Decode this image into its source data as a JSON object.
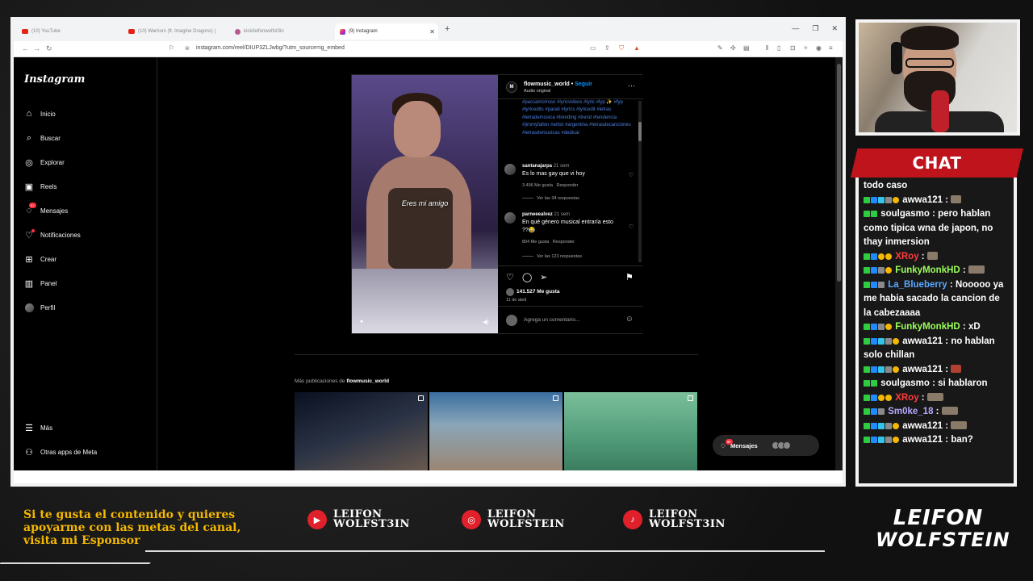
{
  "browser": {
    "tabs": [
      {
        "label": "(10) YouTube",
        "icon": "youtube-icon"
      },
      {
        "label": "(10) Warriors (ft. Imagine Dragons) |",
        "icon": "youtube-icon"
      },
      {
        "label": "kick/leifonwolfst3in",
        "icon": "kick-icon"
      },
      {
        "label": "(9) Instagram",
        "icon": "instagram-icon",
        "active": true
      }
    ],
    "new_tab": "+",
    "url": "instagram.com/reel/DIUP3ZLJwbg/?utm_source=ig_embed"
  },
  "instagram": {
    "logo": "Instagram",
    "nav": [
      {
        "label": "Inicio",
        "icon": "home-icon"
      },
      {
        "label": "Buscar",
        "icon": "search-icon"
      },
      {
        "label": "Explorar",
        "icon": "compass-icon"
      },
      {
        "label": "Reels",
        "icon": "reels-icon"
      },
      {
        "label": "Mensajes",
        "icon": "messenger-icon",
        "badge": "9+"
      },
      {
        "label": "Notificaciones",
        "icon": "heart-icon"
      },
      {
        "label": "Crear",
        "icon": "plus-square-icon"
      },
      {
        "label": "Panel",
        "icon": "dashboard-icon"
      },
      {
        "label": "Perfil",
        "icon": "avatar"
      }
    ],
    "nav_bottom": [
      {
        "label": "Más",
        "icon": "menu-icon"
      },
      {
        "label": "Otras apps de Meta",
        "icon": "meta-apps-icon"
      }
    ],
    "post": {
      "subtitle": "Eres mi amigo",
      "username": "flowmusic_world",
      "follow": "Seguir",
      "audio": "Audio original",
      "caption": "#paccamorroso #lyricvideos #lyric #lyp ✨ #fyp #lyricedits #parati #lyrics #lyricedit #letras #letrademusica #trending #trend #tendencia #jimmyfallon #artist #argentina #letrasdecanciones #letrasdemusicas #dedicar",
      "comments": [
        {
          "user": "santanajarpa",
          "time": "21 sem",
          "text": "Es lo mas gay que vi hoy",
          "likes": "3.496 Me gusta",
          "reply": "Responder",
          "replies": "Ver las 34 respuestas"
        },
        {
          "user": "parneeealvez",
          "time": "21 sem",
          "text": "En qué género musical entraría esto ??😂",
          "likes": "804 Me gusta",
          "reply": "Responder",
          "replies": "Ver las 123 respuestas"
        }
      ],
      "likes": "141.527 Me gusta",
      "date": "11 de abril",
      "add_comment": "Agrega un comentario..."
    },
    "more_posts_prefix": "Más publicaciones de ",
    "more_posts_user": "flowmusic_world",
    "messages_pill": "Mensajes",
    "messages_badge": "9+"
  },
  "chat": {
    "title": "CHAT",
    "messages": [
      {
        "user": "",
        "text": "todo caso",
        "color": "#ffffff"
      },
      {
        "user": "awwa121",
        "text": "",
        "color": "#ffffff",
        "emote": true
      },
      {
        "user": "soulgasmo",
        "text": "pero hablan como tipica wna de japon, no thay inmersion",
        "color": "#ffffff"
      },
      {
        "user": "XRoy",
        "text": "",
        "color": "#ff3b3b",
        "emote": true
      },
      {
        "user": "FunkyMonkHD",
        "text": "",
        "color": "#9cff5a",
        "emote": true
      },
      {
        "user": "La_Blueberry",
        "text": "Nooooo ya me habia sacado la cancion de la cabezaaaa",
        "color": "#5aa8ff"
      },
      {
        "user": "FunkyMonkHD",
        "text": "xD",
        "color": "#9cff5a"
      },
      {
        "user": "awwa121",
        "text": "no hablan solo chillan",
        "color": "#ffffff"
      },
      {
        "user": "awwa121",
        "text": "",
        "color": "#ffffff",
        "emote": true
      },
      {
        "user": "soulgasmo",
        "text": "si hablaron",
        "color": "#ffffff"
      },
      {
        "user": "XRoy",
        "text": "",
        "color": "#ff3b3b",
        "emote": true
      },
      {
        "user": "Sm0ke_18",
        "text": "",
        "color": "#b8a8ff",
        "emote": true
      },
      {
        "user": "awwa121",
        "text": "",
        "color": "#ffffff",
        "emote": true
      },
      {
        "user": "awwa121",
        "text": "ban?",
        "color": "#ffffff"
      }
    ]
  },
  "banner": {
    "sponsor_text": "Si te gusta el contenido y quieres apoyarme con las metas del canal, visita mi Esponsor",
    "socials": [
      {
        "icon": "youtube-icon",
        "line1": "LEIFON",
        "line2": "WOLFST3IN"
      },
      {
        "icon": "instagram-icon",
        "line1": "LEIFON",
        "line2": "WOLFSTEIN"
      },
      {
        "icon": "tiktok-icon",
        "line1": "LEIFON",
        "line2": "WOLFST3IN"
      }
    ],
    "brand_line1": "LEIFON",
    "brand_line2": "WOLFSTEIN"
  },
  "colors": {
    "accent_red": "#c0141c",
    "sponsor_gold": "#f5b800",
    "ig_blue": "#0095f6"
  }
}
